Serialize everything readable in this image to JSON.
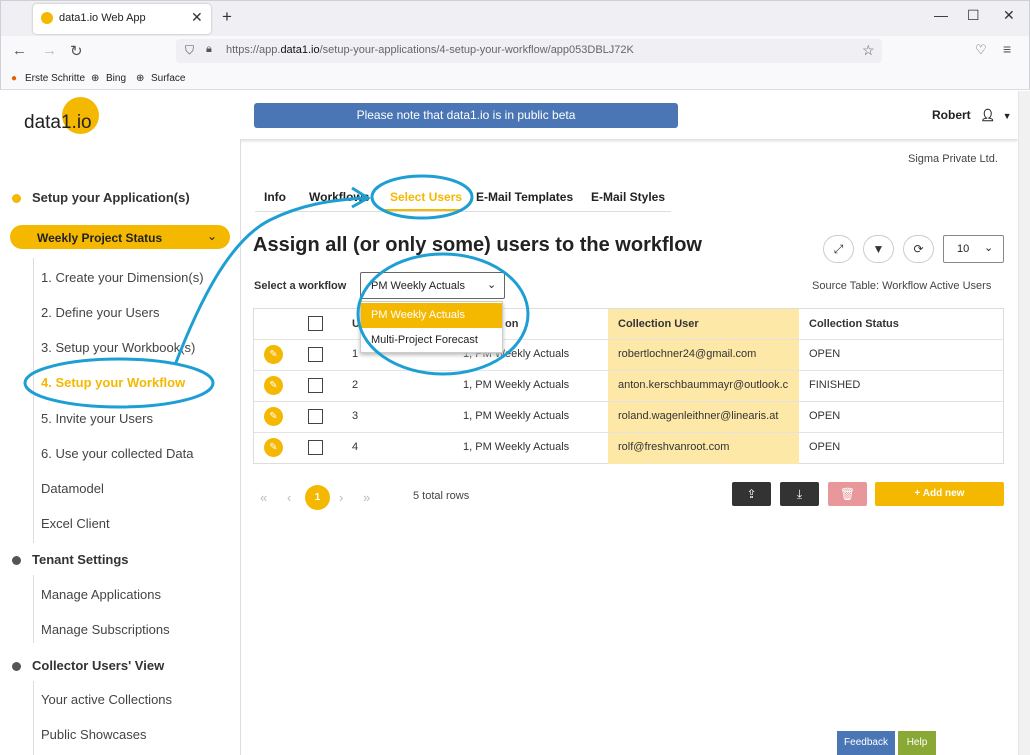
{
  "browser": {
    "tab_title": "data1.io Web App",
    "url_prefix": "https://app.",
    "url_domain": "data1.io",
    "url_path": "/setup-your-applications/4-setup-your-workflow/app053DBLJ72K",
    "bookmarks": [
      "Erste Schritte",
      "Bing",
      "Surface"
    ]
  },
  "header": {
    "logo": "data1.io",
    "beta_notice": "Please note that data1.io is in public beta",
    "user": "Robert"
  },
  "sidebar": {
    "section1": "Setup your Application(s)",
    "app_selected": "Weekly Project Status",
    "steps": [
      "1. Create your Dimension(s)",
      "2. Define your Users",
      "3. Setup your Workbook(s)",
      "4. Setup your Workflow",
      "5. Invite your Users",
      "6. Use your collected Data",
      "Datamodel",
      "Excel Client"
    ],
    "section2": "Tenant Settings",
    "tenant_items": [
      "Manage Applications",
      "Manage Subscriptions"
    ],
    "section3": "Collector Users' View",
    "collector_items": [
      "Your active Collections",
      "Public Showcases"
    ]
  },
  "main": {
    "company": "Sigma Private Ltd.",
    "tabs": [
      "Info",
      "Workflows",
      "Select Users",
      "E-Mail Templates",
      "E-Mail Styles"
    ],
    "heading": "Assign all (or only some) users to the workflow",
    "page_size": "10",
    "workflow_label": "Select a workflow",
    "workflow_selected": "PM Weekly Actuals",
    "workflow_options": [
      "PM Weekly Actuals",
      "Multi-Project Forecast"
    ],
    "source_table": "Source Table: Workflow Active Users",
    "columns": [
      "U",
      "on",
      "Collection User",
      "Collection Status"
    ],
    "rows": [
      {
        "id": "1",
        "workflow": "1, PM Weekly Actuals",
        "user": "robertlochner24@gmail.com",
        "status": "OPEN"
      },
      {
        "id": "2",
        "workflow": "1, PM Weekly Actuals",
        "user": "anton.kerschbaummayr@outlook.c",
        "status": "FINISHED"
      },
      {
        "id": "3",
        "workflow": "1, PM Weekly Actuals",
        "user": "roland.wagenleithner@linearis.at",
        "status": "OPEN"
      },
      {
        "id": "4",
        "workflow": "1, PM Weekly Actuals",
        "user": "rolf@freshvanroot.com",
        "status": "OPEN"
      }
    ],
    "current_page": "1",
    "total_rows": "5 total rows",
    "add_new": "+ Add new"
  },
  "footer": {
    "feedback": "Feedback",
    "help": "Help"
  },
  "colors": {
    "accent": "#f5b800",
    "beta_bar": "#4b76b6",
    "annotation": "#1e9fd4"
  }
}
